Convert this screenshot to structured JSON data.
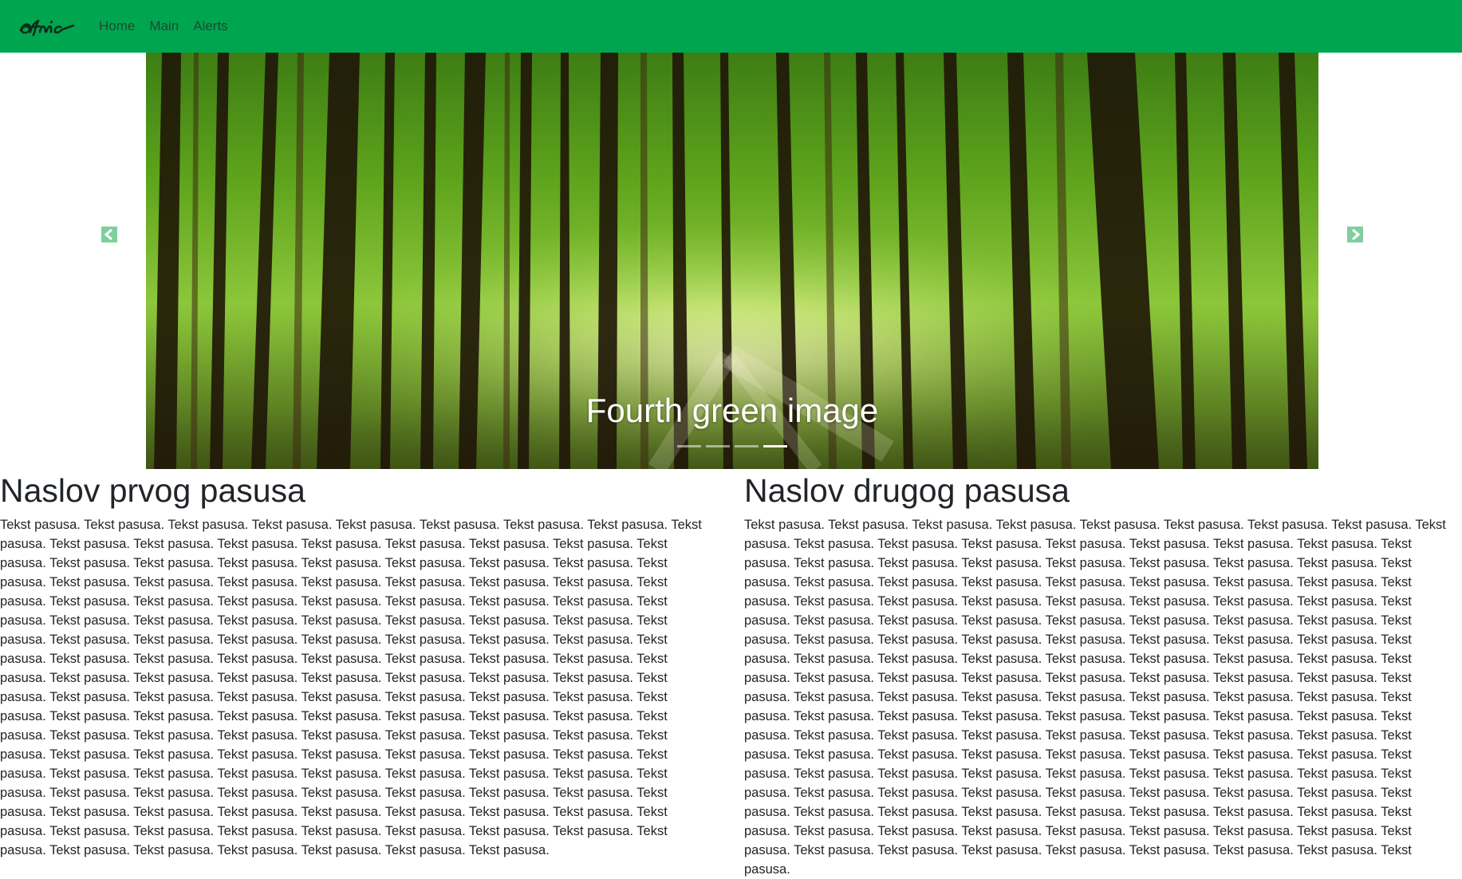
{
  "navbar": {
    "brand": "afnic",
    "links": [
      "Home",
      "Main",
      "Alerts"
    ],
    "background": "#00a550"
  },
  "carousel": {
    "caption": "Fourth green image",
    "indicator_count": 4,
    "active_index": 3,
    "prev_icon": "chevron-left-icon",
    "next_icon": "chevron-right-icon",
    "control_color": "#7fcf9d"
  },
  "sections": [
    {
      "heading": "Naslov prvog pasusa",
      "text": "Tekst pasusa. Tekst pasusa. Tekst pasusa. Tekst pasusa. Tekst pasusa. Tekst pasusa. Tekst pasusa. Tekst pasusa. Tekst pasusa. Tekst pasusa. Tekst pasusa. Tekst pasusa. Tekst pasusa. Tekst pasusa. Tekst pasusa. Tekst pasusa. Tekst pasusa. Tekst pasusa. Tekst pasusa. Tekst pasusa. Tekst pasusa. Tekst pasusa. Tekst pasusa. Tekst pasusa. Tekst pasusa. Tekst pasusa. Tekst pasusa. Tekst pasusa. Tekst pasusa. Tekst pasusa. Tekst pasusa. Tekst pasusa. Tekst pasusa. Tekst pasusa. Tekst pasusa. Tekst pasusa. Tekst pasusa. Tekst pasusa. Tekst pasusa. Tekst pasusa. Tekst pasusa. Tekst pasusa. Tekst pasusa. Tekst pasusa. Tekst pasusa. Tekst pasusa. Tekst pasusa. Tekst pasusa. Tekst pasusa. Tekst pasusa. Tekst pasusa. Tekst pasusa. Tekst pasusa. Tekst pasusa. Tekst pasusa. Tekst pasusa. Tekst pasusa. Tekst pasusa. Tekst pasusa. Tekst pasusa. Tekst pasusa. Tekst pasusa. Tekst pasusa. Tekst pasusa. Tekst pasusa. Tekst pasusa. Tekst pasusa. Tekst pasusa. Tekst pasusa. Tekst pasusa. Tekst pasusa. Tekst pasusa. Tekst pasusa. Tekst pasusa. Tekst pasusa. Tekst pasusa. Tekst pasusa. Tekst pasusa. Tekst pasusa. Tekst pasusa. Tekst pasusa. Tekst pasusa. Tekst pasusa. Tekst pasusa. Tekst pasusa. Tekst pasusa. Tekst pasusa. Tekst pasusa. Tekst pasusa. Tekst pasusa. Tekst pasusa. Tekst pasusa. Tekst pasusa. Tekst pasusa. Tekst pasusa. Tekst pasusa. Tekst pasusa. Tekst pasusa. Tekst pasusa. Tekst pasusa. Tekst pasusa. Tekst pasusa. Tekst pasusa. Tekst pasusa. Tekst pasusa. Tekst pasusa. Tekst pasusa. Tekst pasusa. Tekst pasusa. Tekst pasusa. Tekst pasusa. Tekst pasusa. Tekst pasusa. Tekst pasusa. Tekst pasusa. Tekst pasusa. Tekst pasusa. Tekst pasusa. Tekst pasusa. Tekst pasusa. Tekst pasusa. Tekst pasusa. Tekst pasusa. Tekst pasusa. Tekst pasusa. Tekst pasusa. Tekst pasusa. Tekst pasusa. Tekst pasusa. Tekst pasusa. Tekst pasusa. Tekst pasusa. Tekst pasusa. Tekst pasusa. Tekst pasusa. Tekst pasusa. Tekst pasusa. Tekst pasusa. Tekst pasusa. Tekst pasusa. Tekst pasusa. Tekst pasusa. Tekst pasusa."
    },
    {
      "heading": "Naslov drugog pasusa",
      "text": "Tekst pasusa. Tekst pasusa. Tekst pasusa. Tekst pasusa. Tekst pasusa. Tekst pasusa. Tekst pasusa. Tekst pasusa. Tekst pasusa. Tekst pasusa. Tekst pasusa. Tekst pasusa. Tekst pasusa. Tekst pasusa. Tekst pasusa. Tekst pasusa. Tekst pasusa. Tekst pasusa. Tekst pasusa. Tekst pasusa. Tekst pasusa. Tekst pasusa. Tekst pasusa. Tekst pasusa. Tekst pasusa. Tekst pasusa. Tekst pasusa. Tekst pasusa. Tekst pasusa. Tekst pasusa. Tekst pasusa. Tekst pasusa. Tekst pasusa. Tekst pasusa. Tekst pasusa. Tekst pasusa. Tekst pasusa. Tekst pasusa. Tekst pasusa. Tekst pasusa. Tekst pasusa. Tekst pasusa. Tekst pasusa. Tekst pasusa. Tekst pasusa. Tekst pasusa. Tekst pasusa. Tekst pasusa. Tekst pasusa. Tekst pasusa. Tekst pasusa. Tekst pasusa. Tekst pasusa. Tekst pasusa. Tekst pasusa. Tekst pasusa. Tekst pasusa. Tekst pasusa. Tekst pasusa. Tekst pasusa. Tekst pasusa. Tekst pasusa. Tekst pasusa. Tekst pasusa. Tekst pasusa. Tekst pasusa. Tekst pasusa. Tekst pasusa. Tekst pasusa. Tekst pasusa. Tekst pasusa. Tekst pasusa. Tekst pasusa. Tekst pasusa. Tekst pasusa. Tekst pasusa. Tekst pasusa. Tekst pasusa. Tekst pasusa. Tekst pasusa. Tekst pasusa. Tekst pasusa. Tekst pasusa. Tekst pasusa. Tekst pasusa. Tekst pasusa. Tekst pasusa. Tekst pasusa. Tekst pasusa. Tekst pasusa. Tekst pasusa. Tekst pasusa. Tekst pasusa. Tekst pasusa. Tekst pasusa. Tekst pasusa. Tekst pasusa. Tekst pasusa. Tekst pasusa. Tekst pasusa. Tekst pasusa. Tekst pasusa. Tekst pasusa. Tekst pasusa. Tekst pasusa. Tekst pasusa. Tekst pasusa. Tekst pasusa. Tekst pasusa. Tekst pasusa. Tekst pasusa. Tekst pasusa. Tekst pasusa. Tekst pasusa. Tekst pasusa. Tekst pasusa. Tekst pasusa. Tekst pasusa. Tekst pasusa. Tekst pasusa. Tekst pasusa. Tekst pasusa. Tekst pasusa. Tekst pasusa. Tekst pasusa. Tekst pasusa. Tekst pasusa. Tekst pasusa. Tekst pasusa. Tekst pasusa. Tekst pasusa. Tekst pasusa. Tekst pasusa. Tekst pasusa. Tekst pasusa. Tekst pasusa. Tekst pasusa. Tekst pasusa. Tekst pasusa. Tekst pasusa. Tekst pasusa. Tekst pasusa. Tekst pasusa. Tekst pasusa. Tekst pasusa."
    }
  ]
}
